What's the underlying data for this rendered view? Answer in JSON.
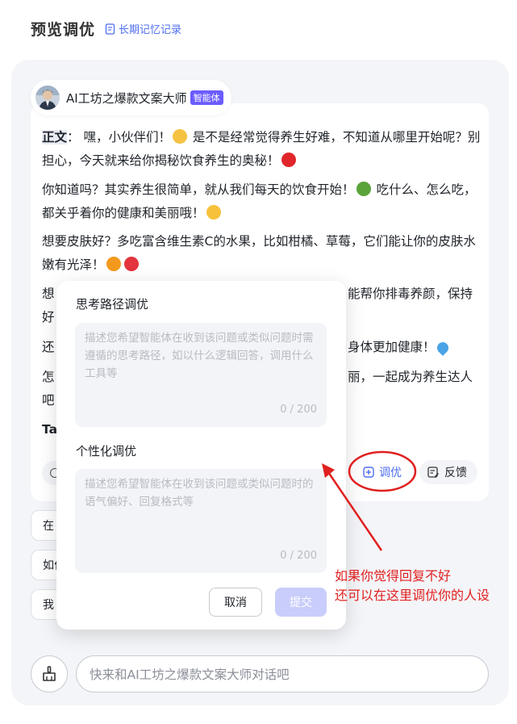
{
  "header": {
    "title": "预览调优",
    "memory_link": "长期记忆记录"
  },
  "agent": {
    "name": "AI工坊之爆款文案大师",
    "badge": "智能体"
  },
  "message": {
    "p1_label": "正文",
    "p1_colon": "：",
    "p1_text_a": " 嘿，小伙伴们！",
    "p1_text_b": " 是不是经常觉得养生好难，不知道从哪里开始呢？别担心，今天就来给你揭秘饮食养生的奥秘！",
    "p2_a": "你知道吗？其实养生很简单，就从我们每天的饮食开始！",
    "p2_b": " 吃什么、怎么吃，都关乎着你的健康和美丽哦！",
    "p3": "想要皮肤好？多吃富含维生素C的水果，比如柑橘、草莓，它们能让你的皮肤水嫩有光泽！",
    "p4_left": "想",
    "p4_right": "能帮你排毒养颜，保持",
    "p4_left2": "好",
    "p5_left": "还",
    "p5_right": "身体更加健康！",
    "p6_left": "怎",
    "p6_right": "丽，一起成为养生达人",
    "p6_left2": "吧",
    "p7_left": "Ta"
  },
  "actions": {
    "tune": "调优",
    "feedback": "反馈"
  },
  "suggestions": [
    "在",
    "如何",
    "我"
  ],
  "popup": {
    "section1_title": "思考路径调优",
    "section1_placeholder": "描述您希望智能体在收到该问题或类似问题时需遵循的思考路径，如以什么逻辑回答，调用什么工具等",
    "section1_count": "0 / 200",
    "section2_title": "个性化调优",
    "section2_placeholder": "描述您希望智能体在收到该问题或类似问题时的语气偏好、回复格式等",
    "section2_count": "0 / 200",
    "cancel": "取消",
    "submit": "提交"
  },
  "input": {
    "placeholder": "快来和AI工坊之爆款文案大师对话吧"
  },
  "annotation": {
    "line1": "如果你觉得回复不好",
    "line2": "还可以在这里调优你的人设"
  },
  "colors": {
    "accent": "#4e6ef2",
    "annotation": "#e02020",
    "badge": "#6a5cff"
  }
}
